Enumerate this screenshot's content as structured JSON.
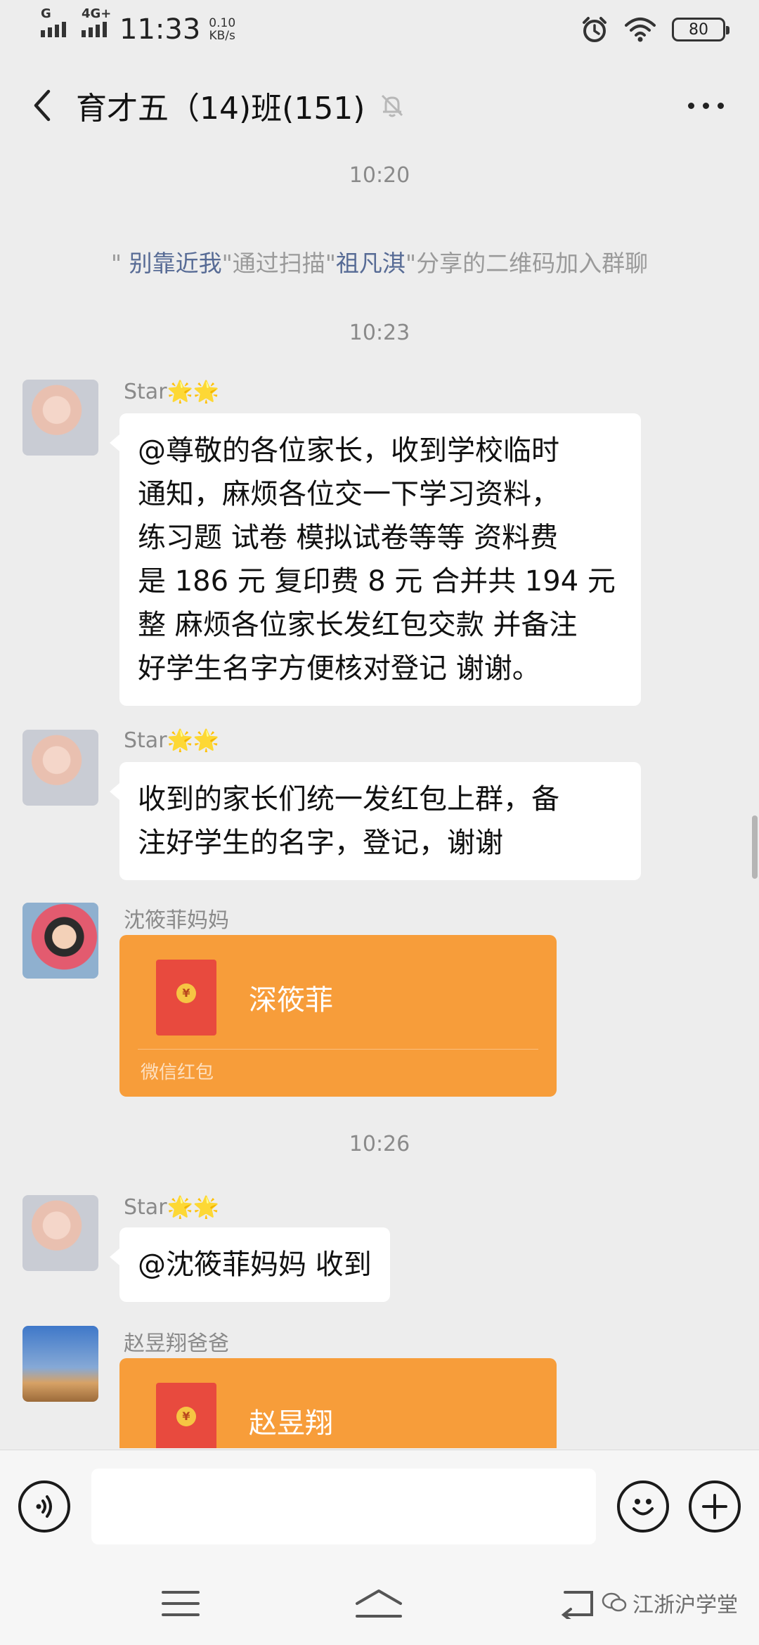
{
  "status_bar": {
    "signal_label_1": "G",
    "signal_label_2": "4G+",
    "time": "11:33",
    "speed_value": "0.10",
    "speed_unit": "KB/s",
    "battery": "80",
    "icons": [
      "signal-icon",
      "alarm-icon",
      "wifi-icon",
      "battery-icon"
    ]
  },
  "header": {
    "title": "育才五（14)班(151)",
    "icons": [
      "back-icon",
      "mute-icon",
      "more-icon"
    ]
  },
  "messages": {
    "time_1": "10:20",
    "system": {
      "prefix": "\" ",
      "user_a": "别靠近我",
      "middle": "\"通过扫描\"",
      "user_b": "祖凡淇",
      "suffix": "\"分享的二维码加入群聊"
    },
    "time_2": "10:23",
    "msg_1": {
      "sender": "Star🌟🌟",
      "lines": [
        "@尊敬的各位家长，收到学校临时",
        "通知，麻烦各位交一下学习资料，",
        "练习题 试卷 模拟试卷等等 资料费",
        "是 186 元 复印费 8 元 合并共 194 元",
        "整 麻烦各位家长发红包交款 并备注",
        "好学生名字方便核对登记 谢谢。"
      ]
    },
    "msg_2": {
      "sender": "Star🌟🌟",
      "lines": [
        "收到的家长们统一发红包上群，备",
        "注好学生的名字，登记，谢谢"
      ]
    },
    "msg_3": {
      "sender": "沈筱菲妈妈",
      "packet_name": "深筱菲",
      "packet_label": "微信红包"
    },
    "time_3": "10:26",
    "msg_4": {
      "sender": "Star🌟🌟",
      "text": "@沈筱菲妈妈  收到"
    },
    "msg_5": {
      "sender": "赵昱翔爸爸",
      "packet_name": "赵昱翔"
    }
  },
  "input_bar": {
    "icons": [
      "voice-icon",
      "emoji-icon",
      "plus-icon"
    ]
  },
  "nav_bar": {
    "icons": [
      "menu-icon",
      "home-icon",
      "back-nav-icon"
    ]
  },
  "watermark": "江浙沪学堂",
  "colors": {
    "background": "#ededed",
    "red_packet": "#f79d3a",
    "envelope": "#e84a3e",
    "link": "#576b95"
  }
}
